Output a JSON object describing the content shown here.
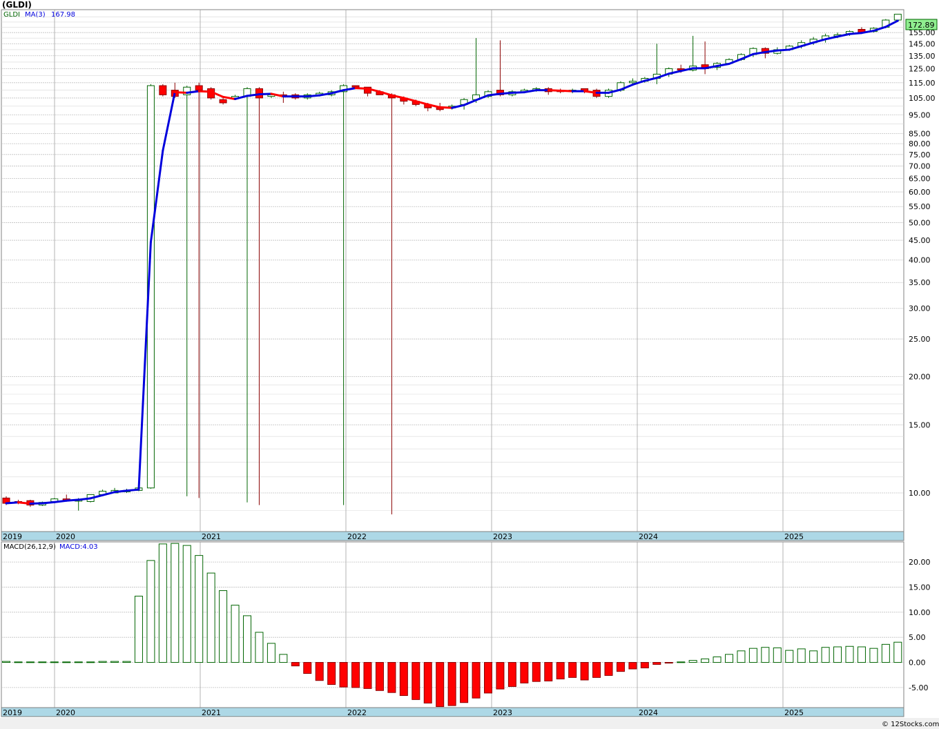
{
  "header": {
    "title": "(GLDI)",
    "symbol": "GLDI",
    "ma_label": "MA(3)",
    "ma_value": "167.98",
    "last_price": "172.89",
    "macd_params": "MACD(26,12,9)",
    "macd_value": "MACD:4.03",
    "credit": "© 12Stocks.com"
  },
  "colors": {
    "up": "#006400",
    "down": "#ff0000",
    "ma_line": "#0000dd",
    "axis_band": "#add8e6",
    "last_price_bg": "#90ee90",
    "grid": "#c0c0c0"
  },
  "x_axis_labels": [
    "2019",
    "2020",
    "2021",
    "2022",
    "2023",
    "2024",
    "2025"
  ],
  "chart_data": [
    {
      "type": "candlestick",
      "title": "(GLDI)",
      "scale": "log",
      "ylim": [
        8.6,
        175
      ],
      "price_ticks": [
        "10.00",
        "15.00",
        "20.00",
        "25.00",
        "30.00",
        "35.00",
        "40.00",
        "45.00",
        "50.00",
        "55.00",
        "60.00",
        "65.00",
        "70.00",
        "75.00",
        "80.00",
        "85.00",
        "95.00",
        "105.00",
        "115.00",
        "125.00",
        "135.00",
        "145.00",
        "155.00"
      ],
      "years": [
        "2019",
        "2020",
        "2021",
        "2022",
        "2023",
        "2024",
        "2025"
      ],
      "grid": true,
      "ma_period": 3,
      "candles": [
        {
          "o": 9.7,
          "h": 9.8,
          "l": 9.3,
          "c": 9.4
        },
        {
          "o": 9.5,
          "h": 9.6,
          "l": 9.35,
          "c": 9.45
        },
        {
          "o": 9.55,
          "h": 9.6,
          "l": 9.2,
          "c": 9.3
        },
        {
          "o": 9.3,
          "h": 9.5,
          "l": 9.25,
          "c": 9.45
        },
        {
          "o": 9.5,
          "h": 9.7,
          "l": 9.4,
          "c": 9.65
        },
        {
          "o": 9.65,
          "h": 9.9,
          "l": 9.5,
          "c": 9.55
        },
        {
          "o": 9.55,
          "h": 9.7,
          "l": 9.0,
          "c": 9.6
        },
        {
          "o": 9.5,
          "h": 9.7,
          "l": 9.45,
          "c": 9.9
        },
        {
          "o": 9.9,
          "h": 10.2,
          "l": 9.85,
          "c": 10.1
        },
        {
          "o": 10.0,
          "h": 10.3,
          "l": 10.0,
          "c": 10.15
        },
        {
          "o": 10.1,
          "h": 10.25,
          "l": 10.0,
          "c": 10.15
        },
        {
          "o": 10.15,
          "h": 10.35,
          "l": 10.1,
          "c": 10.3
        },
        {
          "o": 10.3,
          "h": 114,
          "l": 10.25,
          "c": 113
        },
        {
          "o": 113,
          "h": 114,
          "l": 106,
          "c": 107
        },
        {
          "o": 110,
          "h": 115,
          "l": 105,
          "c": 106
        },
        {
          "o": 107,
          "h": 113,
          "l": 9.8,
          "c": 112
        },
        {
          "o": 113,
          "h": 115,
          "l": 9.7,
          "c": 110
        },
        {
          "o": 111,
          "h": 112,
          "l": 104,
          "c": 105
        },
        {
          "o": 104,
          "h": 105,
          "l": 101,
          "c": 102
        },
        {
          "o": 105,
          "h": 107,
          "l": 104,
          "c": 106
        },
        {
          "o": 106,
          "h": 112,
          "l": 9.45,
          "c": 111
        },
        {
          "o": 111,
          "h": 112,
          "l": 9.3,
          "c": 105
        },
        {
          "o": 106,
          "h": 108,
          "l": 105,
          "c": 107
        },
        {
          "o": 107,
          "h": 109,
          "l": 102,
          "c": 106
        },
        {
          "o": 107,
          "h": 108,
          "l": 104,
          "c": 105
        },
        {
          "o": 105,
          "h": 108,
          "l": 104,
          "c": 107
        },
        {
          "o": 107,
          "h": 109,
          "l": 106,
          "c": 108
        },
        {
          "o": 107,
          "h": 110,
          "l": 106,
          "c": 109
        },
        {
          "o": 109,
          "h": 114,
          "l": 9.3,
          "c": 113
        },
        {
          "o": 113,
          "h": 113,
          "l": 111,
          "c": 112
        },
        {
          "o": 112,
          "h": 112,
          "l": 106,
          "c": 108
        },
        {
          "o": 109,
          "h": 110,
          "l": 107,
          "c": 107
        },
        {
          "o": 107,
          "h": 108,
          "l": 8.8,
          "c": 105
        },
        {
          "o": 105,
          "h": 106,
          "l": 101,
          "c": 103
        },
        {
          "o": 103,
          "h": 104,
          "l": 100,
          "c": 101
        },
        {
          "o": 101,
          "h": 102,
          "l": 97,
          "c": 99
        },
        {
          "o": 99,
          "h": 102,
          "l": 97,
          "c": 98
        },
        {
          "o": 99,
          "h": 101,
          "l": 98,
          "c": 100
        },
        {
          "o": 101,
          "h": 105,
          "l": 98,
          "c": 104
        },
        {
          "o": 104,
          "h": 150,
          "l": 102,
          "c": 107
        },
        {
          "o": 106,
          "h": 110,
          "l": 105,
          "c": 109
        },
        {
          "o": 110,
          "h": 148,
          "l": 106,
          "c": 107
        },
        {
          "o": 107,
          "h": 110,
          "l": 106,
          "c": 109
        },
        {
          "o": 109,
          "h": 111,
          "l": 108,
          "c": 110
        },
        {
          "o": 110,
          "h": 112,
          "l": 109,
          "c": 111
        },
        {
          "o": 111,
          "h": 112,
          "l": 107,
          "c": 109
        },
        {
          "o": 110,
          "h": 111,
          "l": 108,
          "c": 109
        },
        {
          "o": 109,
          "h": 111,
          "l": 108,
          "c": 110
        },
        {
          "o": 111,
          "h": 111,
          "l": 108,
          "c": 109
        },
        {
          "o": 110,
          "h": 111,
          "l": 105,
          "c": 106
        },
        {
          "o": 106,
          "h": 111,
          "l": 105,
          "c": 110
        },
        {
          "o": 110,
          "h": 116,
          "l": 109,
          "c": 115
        },
        {
          "o": 115,
          "h": 118,
          "l": 113,
          "c": 116
        },
        {
          "o": 116,
          "h": 119,
          "l": 115,
          "c": 118
        },
        {
          "o": 118,
          "h": 145,
          "l": 114,
          "c": 121
        },
        {
          "o": 121,
          "h": 126,
          "l": 119,
          "c": 125
        },
        {
          "o": 125,
          "h": 128,
          "l": 122,
          "c": 124
        },
        {
          "o": 124,
          "h": 152,
          "l": 123,
          "c": 127
        },
        {
          "o": 128,
          "h": 147,
          "l": 121,
          "c": 125
        },
        {
          "o": 126,
          "h": 130,
          "l": 124,
          "c": 129
        },
        {
          "o": 129,
          "h": 133,
          "l": 128,
          "c": 132
        },
        {
          "o": 132,
          "h": 137,
          "l": 131,
          "c": 136
        },
        {
          "o": 136,
          "h": 142,
          "l": 134,
          "c": 141
        },
        {
          "o": 141,
          "h": 142,
          "l": 133,
          "c": 137
        },
        {
          "o": 137,
          "h": 142,
          "l": 136,
          "c": 140
        },
        {
          "o": 140,
          "h": 144,
          "l": 139,
          "c": 143
        },
        {
          "o": 143,
          "h": 148,
          "l": 141,
          "c": 146
        },
        {
          "o": 146,
          "h": 151,
          "l": 144,
          "c": 149
        },
        {
          "o": 149,
          "h": 154,
          "l": 146,
          "c": 152
        },
        {
          "o": 152,
          "h": 155,
          "l": 150,
          "c": 153
        },
        {
          "o": 154,
          "h": 157,
          "l": 152,
          "c": 156
        },
        {
          "o": 158,
          "h": 160,
          "l": 154,
          "c": 155
        },
        {
          "o": 156,
          "h": 160,
          "l": 155,
          "c": 159
        },
        {
          "o": 160,
          "h": 168,
          "l": 159,
          "c": 167
        },
        {
          "o": 167,
          "h": 173,
          "l": 166,
          "c": 172.89
        }
      ]
    },
    {
      "type": "bar",
      "title": "MACD(26,12,9)",
      "ylim": [
        -9,
        24
      ],
      "y_ticks": [
        "-5.00",
        "0.00",
        "5.00",
        "10.00",
        "15.00",
        "20.00"
      ],
      "years": [
        "2019",
        "2020",
        "2021",
        "2022",
        "2023",
        "2024",
        "2025"
      ],
      "values": [
        0.2,
        0.1,
        0.1,
        0.1,
        0.1,
        0.1,
        0.1,
        0.1,
        0.2,
        0.2,
        0.2,
        13.2,
        20.3,
        23.6,
        23.7,
        23.3,
        21.3,
        17.8,
        14.3,
        11.4,
        9.3,
        6.0,
        3.8,
        1.6,
        -0.7,
        -2.2,
        -3.6,
        -4.4,
        -4.9,
        -5.0,
        -5.2,
        -5.6,
        -6.0,
        -6.6,
        -7.4,
        -8.1,
        -8.8,
        -8.6,
        -8.0,
        -7.1,
        -6.1,
        -5.3,
        -4.8,
        -4.1,
        -3.8,
        -3.7,
        -3.3,
        -3.0,
        -3.5,
        -3.0,
        -2.6,
        -1.8,
        -1.3,
        -1.1,
        -0.4,
        -0.1,
        0.1,
        0.4,
        0.7,
        1.1,
        1.6,
        2.3,
        2.8,
        3.0,
        2.9,
        2.4,
        2.7,
        2.3,
        3.0,
        3.1,
        3.2,
        3.1,
        2.8,
        3.6,
        4.03
      ]
    }
  ]
}
